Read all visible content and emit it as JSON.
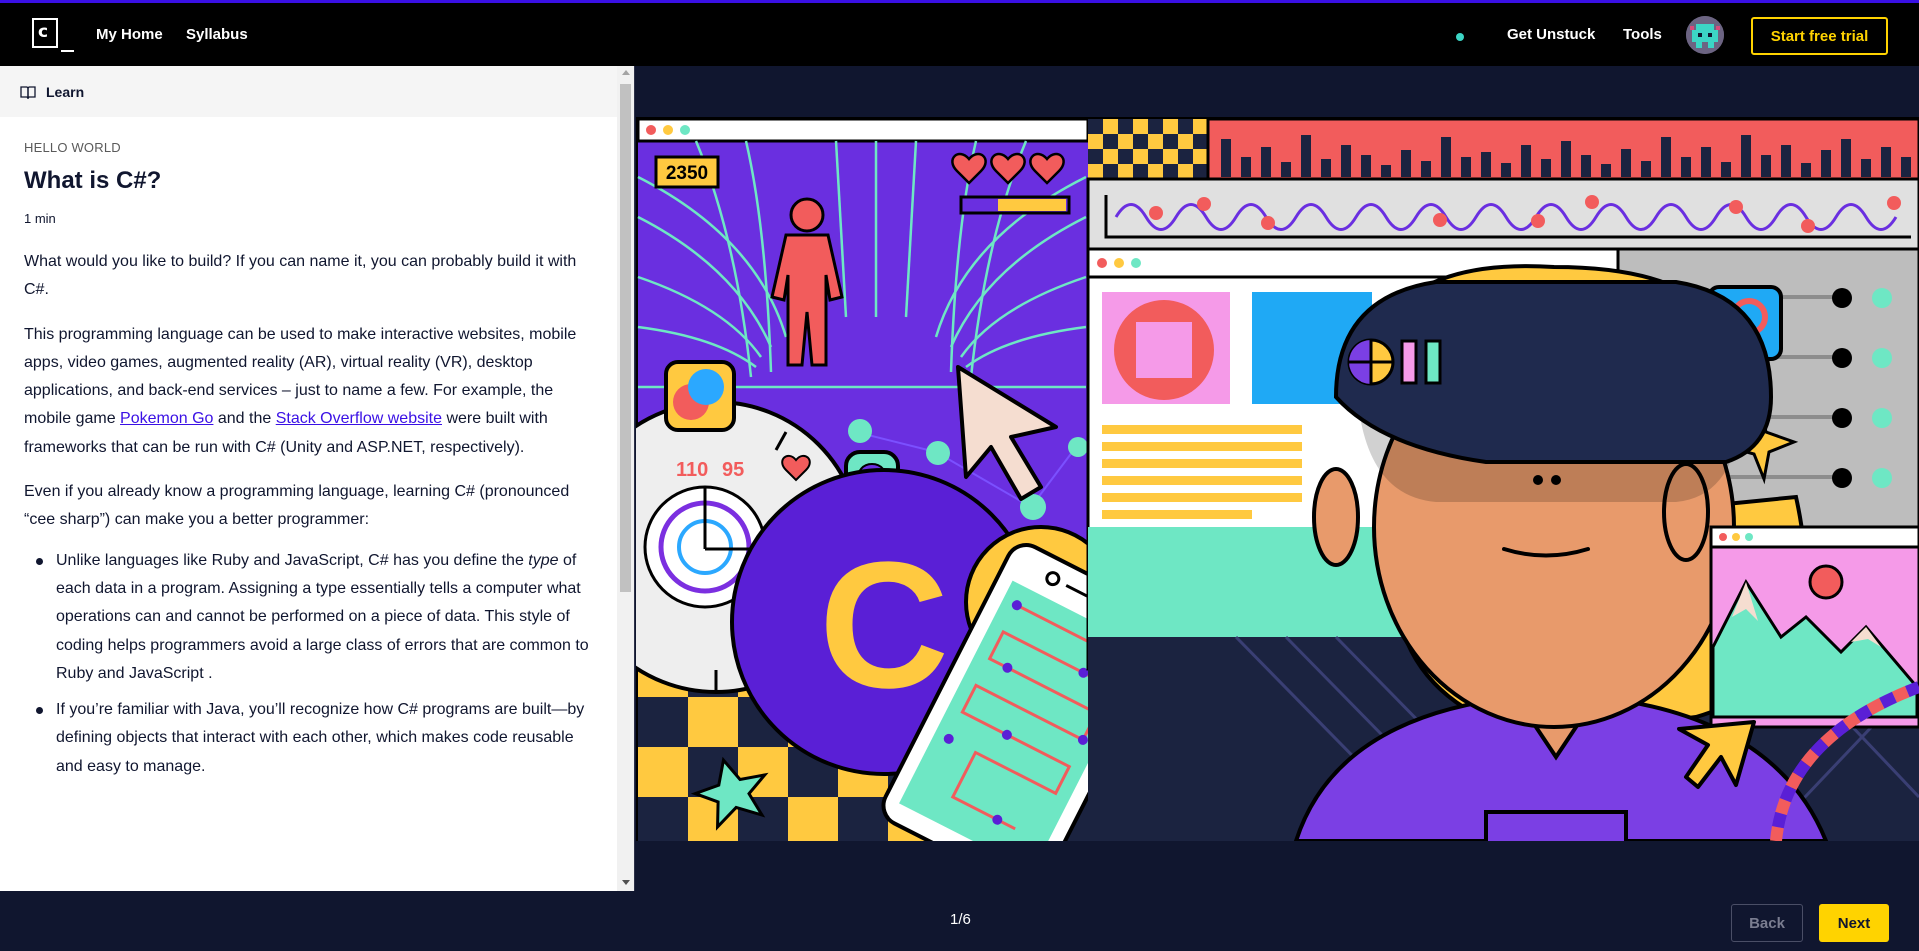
{
  "nav": {
    "logo_letter": "c",
    "links": [
      "My Home",
      "Syllabus"
    ],
    "right_links": [
      "Get Unstuck",
      "Tools"
    ],
    "trial_button": "Start free trial"
  },
  "sidebar": {
    "section_label": "Learn"
  },
  "lesson": {
    "kicker": "HELLO WORLD",
    "title": "What is C#?",
    "time": "1 min",
    "p1": "What would you like to build? If you can name it, you can probably build it with C#.",
    "p2_before": "This programming language can be used to make interactive websites, mobile apps, video games, augmented reality (AR), virtual reality (VR), desktop applications, and back-end services – just to name a few. For example, the mobile game ",
    "p2_link1": "Pokemon Go",
    "p2_mid": " and the ",
    "p2_link2": "Stack Overflow website",
    "p2_after": " were built with frameworks that can be run with C# (Unity and ASP.NET, respectively).",
    "p3": "Even if you already know a programming language, learning C# (pronounced “cee sharp”) can make you a better programmer:",
    "bullet1_before": "Unlike languages like Ruby and JavaScript, C# has you define the ",
    "bullet1_em": "type",
    "bullet1_after": " of each data in a program. Assigning a type essentially tells a computer what operations can and cannot be performed on a piece of data. This style of coding helps programmers avoid a large class of errors that are common to Ruby and JavaScript .",
    "bullet2": "If you’re familiar with Java, you’ll recognize how C# programs are built—by defining objects that interact with each other, which makes code reusable and easy to manage."
  },
  "illustration": {
    "score": "2350",
    "gauge_left": "110",
    "gauge_right": "95",
    "big_letter": "C",
    "hash": "#"
  },
  "footer": {
    "pager": "1/6",
    "back": "Back",
    "next": "Next"
  },
  "colors": {
    "accent_yellow": "#ffd300",
    "brand_blue": "#3a10e5",
    "navy": "#10162f"
  }
}
